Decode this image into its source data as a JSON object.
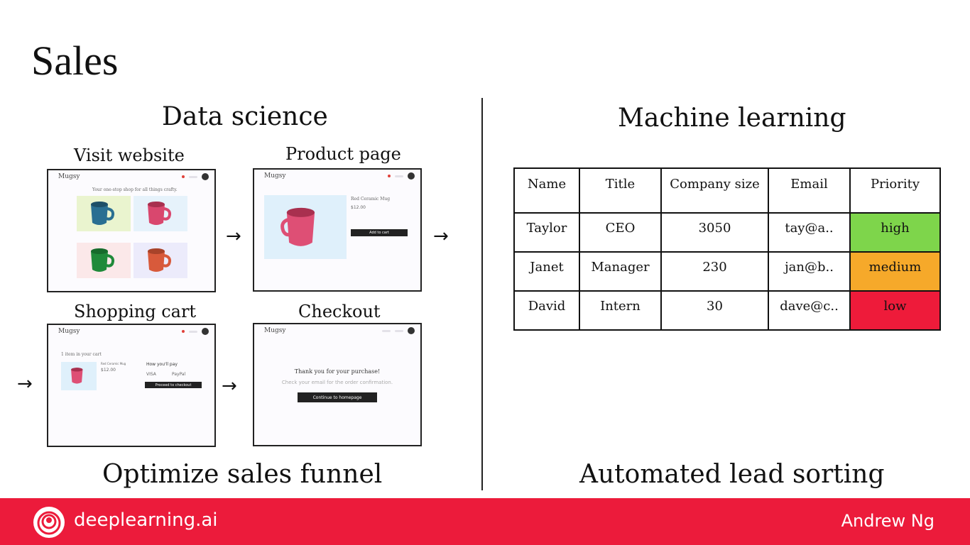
{
  "slide": {
    "title": "Sales"
  },
  "data_science": {
    "heading": "Data science",
    "caption": "Optimize sales funnel",
    "steps": [
      {
        "label": "Visit website"
      },
      {
        "label": "Product page"
      },
      {
        "label": "Shopping cart"
      },
      {
        "label": "Checkout"
      }
    ],
    "mockups": {
      "brand": "Mugsy",
      "home_tagline": "Your one-stop shop for all things crafty.",
      "product_name": "Red Ceramic Mug",
      "product_price": "$12.00",
      "add_to_cart": "Add to cart",
      "cart_heading": "1 item in your cart",
      "pay_heading": "How you'll pay",
      "pay_option_visa": "VISA",
      "pay_option_paypal": "PayPal",
      "proceed_label": "Proceed to checkout",
      "thanks": "Thank you for your purchase!",
      "check_email": "Check your email for the order confirmation.",
      "continue_label": "Continue to homepage"
    },
    "arrow_glyph": "→"
  },
  "machine_learning": {
    "heading": "Machine learning",
    "caption": "Automated lead sorting",
    "table": {
      "headers": [
        "Name",
        "Title",
        "Company size",
        "Email",
        "Priority"
      ],
      "rows": [
        [
          "Taylor",
          "CEO",
          "3050",
          "tay@a..",
          "high"
        ],
        [
          "Janet",
          "Manager",
          "230",
          "jan@b..",
          "medium"
        ],
        [
          "David",
          "Intern",
          "30",
          "dave@c..",
          "low"
        ]
      ]
    },
    "priority_colors": {
      "high": "#7ed54b",
      "medium": "#f6a92a",
      "low": "#ee1b3a"
    }
  },
  "footer": {
    "brand": "deeplearning.ai",
    "author": "Andrew Ng",
    "bar_color": "#ec1b3b",
    "logo_icon": "deeplearning-spiral-icon"
  }
}
